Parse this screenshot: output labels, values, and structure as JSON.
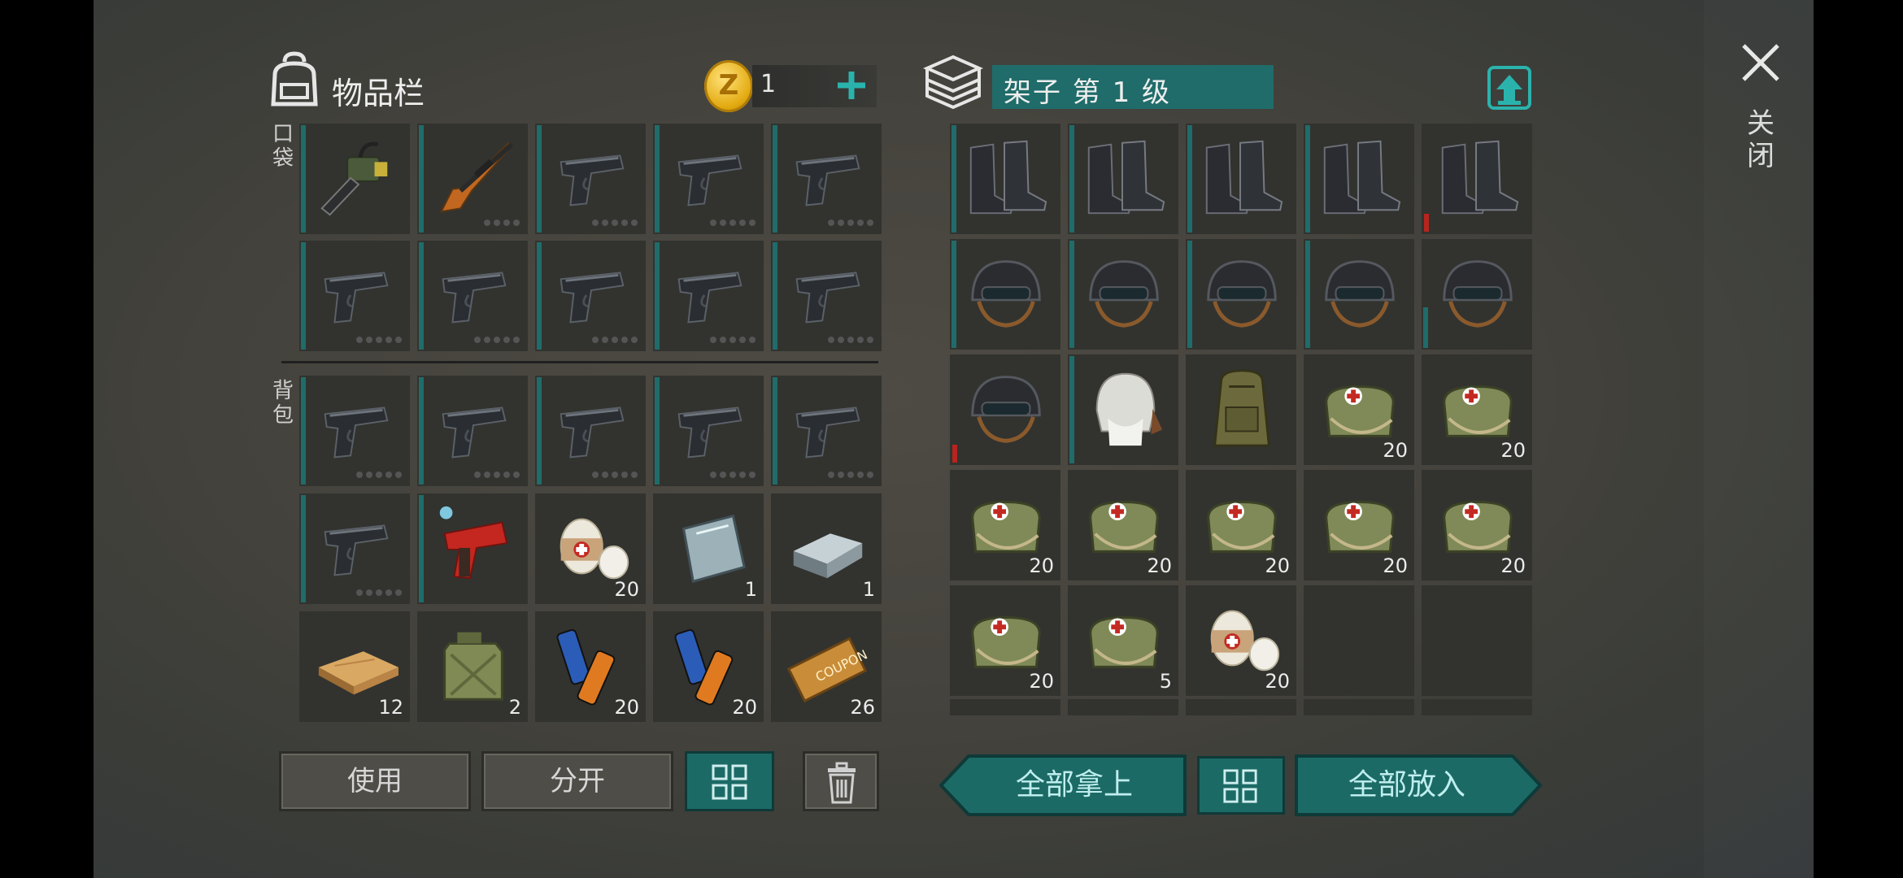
{
  "inventory": {
    "title": "物品栏",
    "coins": "1",
    "coin_symbol": "Z",
    "pocket_label": "口袋",
    "backpack_label": "背包",
    "pocket": [
      {
        "icon": "chainsaw-icon",
        "dots": 0,
        "qty": ""
      },
      {
        "icon": "sniper-rifle-icon",
        "dots": 4,
        "qty": ""
      },
      {
        "icon": "pistol-icon",
        "dots": 5,
        "qty": ""
      },
      {
        "icon": "pistol-icon",
        "dots": 5,
        "qty": ""
      },
      {
        "icon": "pistol-icon",
        "dots": 5,
        "qty": ""
      },
      {
        "icon": "pistol-icon",
        "dots": 5,
        "qty": ""
      },
      {
        "icon": "pistol-icon",
        "dots": 5,
        "qty": ""
      },
      {
        "icon": "pistol-icon",
        "dots": 5,
        "qty": ""
      },
      {
        "icon": "pistol-icon",
        "dots": 5,
        "qty": ""
      },
      {
        "icon": "pistol-icon",
        "dots": 5,
        "qty": ""
      }
    ],
    "backpack": [
      {
        "icon": "pistol-icon",
        "dots": 5,
        "qty": ""
      },
      {
        "icon": "pistol-icon",
        "dots": 5,
        "qty": ""
      },
      {
        "icon": "pistol-icon",
        "dots": 5,
        "qty": ""
      },
      {
        "icon": "pistol-icon",
        "dots": 5,
        "qty": ""
      },
      {
        "icon": "pistol-icon",
        "dots": 5,
        "qty": ""
      },
      {
        "icon": "pistol-icon",
        "dots": 5,
        "qty": ""
      },
      {
        "icon": "flare-gun-icon",
        "dots": 0,
        "qty": ""
      },
      {
        "icon": "bandage-icon",
        "dots": 0,
        "qty": "20"
      },
      {
        "icon": "glass-sheet-icon",
        "dots": 0,
        "qty": "1"
      },
      {
        "icon": "metal-ingot-icon",
        "dots": 0,
        "qty": "1"
      },
      {
        "icon": "wood-plank-icon",
        "dots": 0,
        "qty": "12"
      },
      {
        "icon": "jerrycan-icon",
        "dots": 0,
        "qty": "2"
      },
      {
        "icon": "batteries-icon",
        "dots": 0,
        "qty": "20"
      },
      {
        "icon": "batteries-icon",
        "dots": 0,
        "qty": "20"
      },
      {
        "icon": "coupon-icon",
        "dots": 0,
        "qty": "26"
      }
    ],
    "use_label": "使用",
    "split_label": "分开"
  },
  "shelf": {
    "title": "架子 第 1 级",
    "items": [
      {
        "icon": "boots-icon",
        "qty": "",
        "bar": "full"
      },
      {
        "icon": "boots-icon",
        "qty": "",
        "bar": "full"
      },
      {
        "icon": "boots-icon",
        "qty": "",
        "bar": "full"
      },
      {
        "icon": "boots-icon",
        "qty": "",
        "bar": "full"
      },
      {
        "icon": "boots-icon",
        "qty": "",
        "bar": "red"
      },
      {
        "icon": "helmet-icon",
        "qty": "",
        "bar": "full"
      },
      {
        "icon": "helmet-icon",
        "qty": "",
        "bar": "full"
      },
      {
        "icon": "helmet-icon",
        "qty": "",
        "bar": "full"
      },
      {
        "icon": "helmet-icon",
        "qty": "",
        "bar": "full"
      },
      {
        "icon": "helmet-icon",
        "qty": "",
        "bar": "short"
      },
      {
        "icon": "helmet-icon",
        "qty": "",
        "bar": "red"
      },
      {
        "icon": "aviator-hat-icon",
        "qty": "",
        "bar": "full"
      },
      {
        "icon": "backpack-icon",
        "qty": "",
        "bar": "none"
      },
      {
        "icon": "medkit-bag-icon",
        "qty": "20",
        "bar": "none"
      },
      {
        "icon": "medkit-bag-icon",
        "qty": "20",
        "bar": "none"
      },
      {
        "icon": "medkit-bag-icon",
        "qty": "20",
        "bar": "none"
      },
      {
        "icon": "medkit-bag-icon",
        "qty": "20",
        "bar": "none"
      },
      {
        "icon": "medkit-bag-icon",
        "qty": "20",
        "bar": "none"
      },
      {
        "icon": "medkit-bag-icon",
        "qty": "20",
        "bar": "none"
      },
      {
        "icon": "medkit-bag-icon",
        "qty": "20",
        "bar": "none"
      },
      {
        "icon": "medkit-bag-icon",
        "qty": "20",
        "bar": "none"
      },
      {
        "icon": "medkit-bag-icon",
        "qty": "5",
        "bar": "none"
      },
      {
        "icon": "bandage-icon",
        "qty": "20",
        "bar": "none"
      },
      {
        "icon": "",
        "qty": "",
        "bar": "none"
      },
      {
        "icon": "",
        "qty": "",
        "bar": "none"
      }
    ],
    "take_all_label": "全部拿上",
    "put_all_label": "全部放入"
  },
  "close_label": "关闭",
  "colors": {
    "accent": "#1c6a66",
    "accent_dark": "#0e3a38",
    "cell_bg": "#32332f",
    "durability_red": "#b8241e"
  }
}
